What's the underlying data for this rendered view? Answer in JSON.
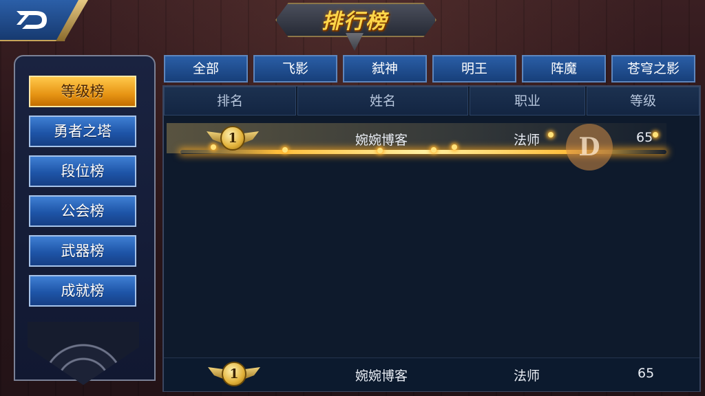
{
  "header": {
    "title": "排行榜",
    "back_icon": "back-d-logo-icon"
  },
  "sidebar": {
    "items": [
      {
        "label": "等级榜",
        "active": true
      },
      {
        "label": "勇者之塔",
        "active": false
      },
      {
        "label": "段位榜",
        "active": false
      },
      {
        "label": "公会榜",
        "active": false
      },
      {
        "label": "武器榜",
        "active": false
      },
      {
        "label": "成就榜",
        "active": false
      }
    ]
  },
  "tabs": [
    {
      "label": "全部"
    },
    {
      "label": "飞影"
    },
    {
      "label": "弑神"
    },
    {
      "label": "明王"
    },
    {
      "label": "阵魔"
    },
    {
      "label": "苍穹之影"
    }
  ],
  "table": {
    "columns": [
      "排名",
      "姓名",
      "职业",
      "等级"
    ],
    "rows": [
      {
        "rank": "1",
        "name": "婉婉博客",
        "job": "法师",
        "level": "65"
      }
    ]
  },
  "self_row": {
    "rank": "1",
    "name": "婉婉博客",
    "job": "法师",
    "level": "65"
  },
  "watermark": {
    "letter": "D"
  },
  "colors": {
    "accent_gold": "#ffc84b",
    "tab_blue": "#2a5ea6",
    "panel_bg": "#0e1a2c"
  }
}
